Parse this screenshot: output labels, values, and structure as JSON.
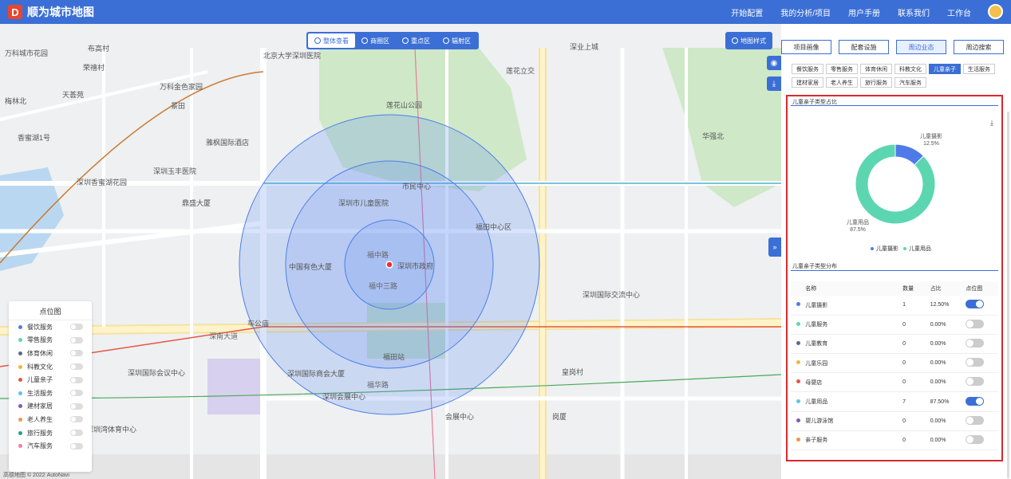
{
  "header": {
    "logo": "D",
    "title": "顺为城市地图",
    "nav": [
      "开始配置",
      "我的分析/项目",
      "用户手册",
      "联系我们",
      "工作台"
    ]
  },
  "toolbar": {
    "buttons": [
      {
        "label": "整体查看",
        "active": true
      },
      {
        "label": "商圈区",
        "active": false
      },
      {
        "label": "重点区",
        "active": false
      },
      {
        "label": "辐射区",
        "active": false
      }
    ]
  },
  "map": {
    "style_button": "地图样式",
    "attribution": "高德地图 © 2022 AutoNavi",
    "labels": [
      {
        "t": "万科城市花园"
      },
      {
        "t": "布高村"
      },
      {
        "t": "荣禧村"
      },
      {
        "t": "北京大学深圳医院"
      },
      {
        "t": "万科金色家园"
      },
      {
        "t": "深业上城"
      },
      {
        "t": "莲花立交"
      },
      {
        "t": "梅林北"
      },
      {
        "t": "天荟苑"
      },
      {
        "t": "景田"
      },
      {
        "t": "香蜜湖1号"
      },
      {
        "t": "雅枫国际酒店"
      },
      {
        "t": "莲花山公园"
      },
      {
        "t": "深圳香蜜湖花园"
      },
      {
        "t": "深圳玉丰医院"
      },
      {
        "t": "鼎盛大厦"
      },
      {
        "t": "深圳市儿童医院"
      },
      {
        "t": "市民中心"
      },
      {
        "t": "福田中心区"
      },
      {
        "t": "深南大道"
      },
      {
        "t": "福华路"
      },
      {
        "t": "中国有色大厦"
      },
      {
        "t": "车公庙"
      },
      {
        "t": "深圳国际商会大厦"
      },
      {
        "t": "皇岗村"
      },
      {
        "t": "深圳会展中心"
      },
      {
        "t": "华强北"
      },
      {
        "t": "深圳市政府"
      },
      {
        "t": "福中三路"
      },
      {
        "t": "福中路"
      },
      {
        "t": "深圳国际交流中心"
      },
      {
        "t": "深圳国际会议中心"
      },
      {
        "t": "会展中心"
      },
      {
        "t": "岗厦"
      },
      {
        "t": "福田站"
      },
      {
        "t": "深圳湾体育中心"
      }
    ]
  },
  "legend": {
    "title": "点位图",
    "items": [
      {
        "label": "餐饮服务",
        "color": "#4f7be8"
      },
      {
        "label": "零售服务",
        "color": "#5cd6b0"
      },
      {
        "label": "体育休闲",
        "color": "#5b6a8a"
      },
      {
        "label": "科教文化",
        "color": "#f2b53a"
      },
      {
        "label": "儿童亲子",
        "color": "#e8563f"
      },
      {
        "label": "生活服务",
        "color": "#62c1e8"
      },
      {
        "label": "建材家居",
        "color": "#8458b3"
      },
      {
        "label": "老人养生",
        "color": "#f59447"
      },
      {
        "label": "旅行服务",
        "color": "#2d9c8c"
      },
      {
        "label": "汽车服务",
        "color": "#f27ea0"
      }
    ]
  },
  "panel": {
    "tabs": [
      {
        "label": "项目画像",
        "active": false
      },
      {
        "label": "配套设施",
        "active": false
      },
      {
        "label": "周边业态",
        "active": true
      },
      {
        "label": "周边搜索",
        "active": false
      }
    ],
    "categories": [
      {
        "label": "餐饮服务",
        "active": false
      },
      {
        "label": "零售服务",
        "active": false
      },
      {
        "label": "体育休闲",
        "active": false
      },
      {
        "label": "科教文化",
        "active": false
      },
      {
        "label": "儿童亲子",
        "active": true
      },
      {
        "label": "生活服务",
        "active": false
      },
      {
        "label": "建材家居",
        "active": false
      },
      {
        "label": "老人养生",
        "active": false
      },
      {
        "label": "旅行服务",
        "active": false
      },
      {
        "label": "汽车服务",
        "active": false
      }
    ],
    "chart_title": "儿童亲子类型占比",
    "table_title": "儿童亲子类型分布",
    "table_headers": [
      "名称",
      "数量",
      "占比",
      "点位图"
    ],
    "rows": [
      {
        "name": "儿童摄影",
        "count": "1",
        "pct": "12.50%",
        "color": "#4f7be8",
        "on": true
      },
      {
        "name": "儿童服务",
        "count": "0",
        "pct": "0.00%",
        "color": "#5cd6b0",
        "on": false
      },
      {
        "name": "儿童教育",
        "count": "0",
        "pct": "0.00%",
        "color": "#5b6a8a",
        "on": false
      },
      {
        "name": "儿童乐园",
        "count": "0",
        "pct": "0.00%",
        "color": "#f2b53a",
        "on": false
      },
      {
        "name": "母婴店",
        "count": "0",
        "pct": "0.00%",
        "color": "#e8563f",
        "on": false
      },
      {
        "name": "儿童用品",
        "count": "7",
        "pct": "87.50%",
        "color": "#62c1e8",
        "on": true
      },
      {
        "name": "婴儿游泳馆",
        "count": "0",
        "pct": "0.00%",
        "color": "#8458b3",
        "on": false
      },
      {
        "name": "亲子服务",
        "count": "0",
        "pct": "0.00%",
        "color": "#f59447",
        "on": false
      }
    ]
  },
  "chart_data": {
    "type": "pie",
    "categories": [
      "儿童摄影",
      "儿童用品"
    ],
    "values": [
      12.5,
      87.5
    ],
    "colors": [
      "#4f7be8",
      "#5cd6b0"
    ],
    "data_labels": [
      "儿童摄影\n12.5%",
      "儿童用品\n87.5%"
    ],
    "legend": [
      "儿童摄影",
      "儿童用品"
    ],
    "legend_position": "bottom"
  }
}
